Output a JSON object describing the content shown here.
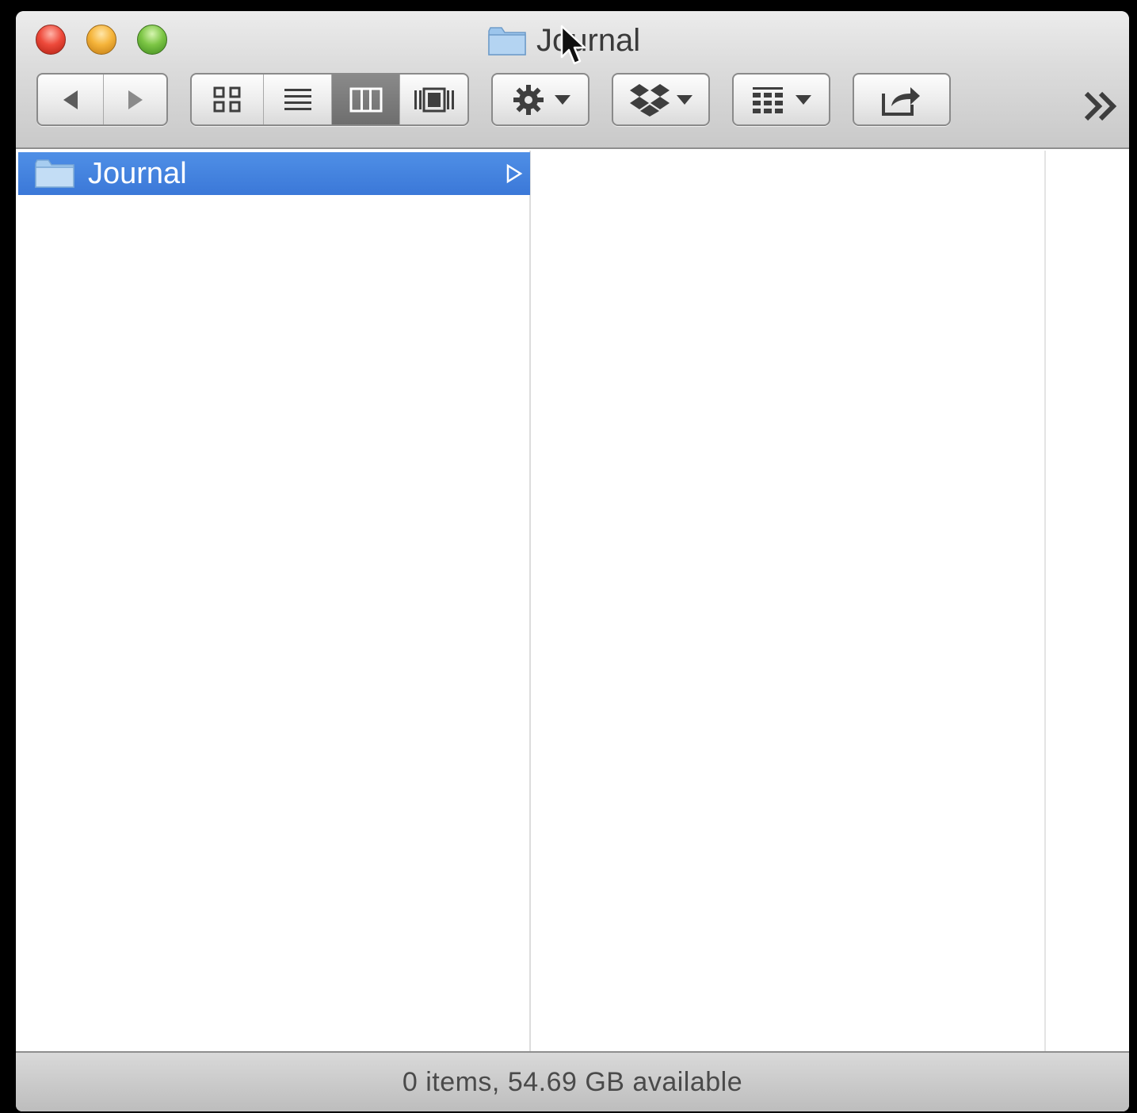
{
  "window": {
    "title": "Journal"
  },
  "toolbar": {
    "nav": [
      "back-arrow-icon",
      "forward-arrow-icon"
    ],
    "views": [
      "icon-view-icon",
      "list-view-icon",
      "column-view-icon",
      "cover-flow-icon"
    ],
    "active_view": "column-view",
    "action_menu": "gear-icon",
    "dropbox_menu": "dropbox-icon",
    "arrange_menu": "arrange-grid-icon",
    "share": "share-icon",
    "overflow": "chevron-double-right-icon"
  },
  "columns": [
    {
      "items": [
        {
          "label": "Journal",
          "selected": true,
          "icon": "folder-icon",
          "has_children": true
        }
      ]
    },
    {
      "items": []
    }
  ],
  "status": {
    "text": "0 items, 54.69 GB available"
  },
  "colors": {
    "selection": "#3b78d8",
    "folder": "#8fbde9",
    "close": "#ee4a3b",
    "minimize": "#f5b43a",
    "zoom": "#7dc645"
  }
}
